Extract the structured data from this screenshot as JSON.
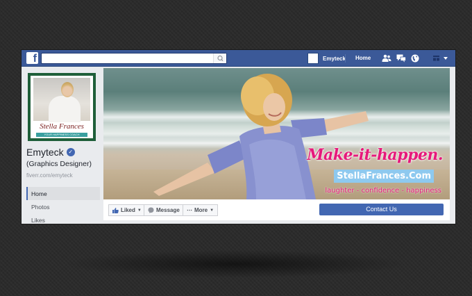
{
  "topbar": {
    "logo": "f",
    "search_placeholder": "",
    "profile_name": "Emyteck",
    "home_label": "Home",
    "icons": [
      "friends-icon",
      "messages-icon",
      "globe-icon",
      "settings-icon"
    ]
  },
  "sidebar": {
    "profile_pic_name": "Stella Frances",
    "profile_pic_tagline": "YOUR HAPPINESS COACH",
    "page_name": "Emyteck",
    "verified_glyph": "✓",
    "page_category": "(Graphics Designer)",
    "page_url": "fiverr.com/emyteck",
    "nav": [
      {
        "label": "Home",
        "active": true
      },
      {
        "label": "Photos",
        "active": false
      },
      {
        "label": "Likes",
        "active": false
      }
    ]
  },
  "cover": {
    "line1": "Make-it-happen.",
    "line2": "StellaFrances.Com",
    "line3": "laughter - confidence - happiness"
  },
  "actions": {
    "liked": "Liked",
    "message": "Message",
    "more": "More",
    "contact": "Contact Us"
  },
  "colors": {
    "brand": "#3b5998",
    "primary_button": "#4267b2",
    "cover_text": "#e6197b",
    "cover_badge": "#8ec9ef"
  }
}
